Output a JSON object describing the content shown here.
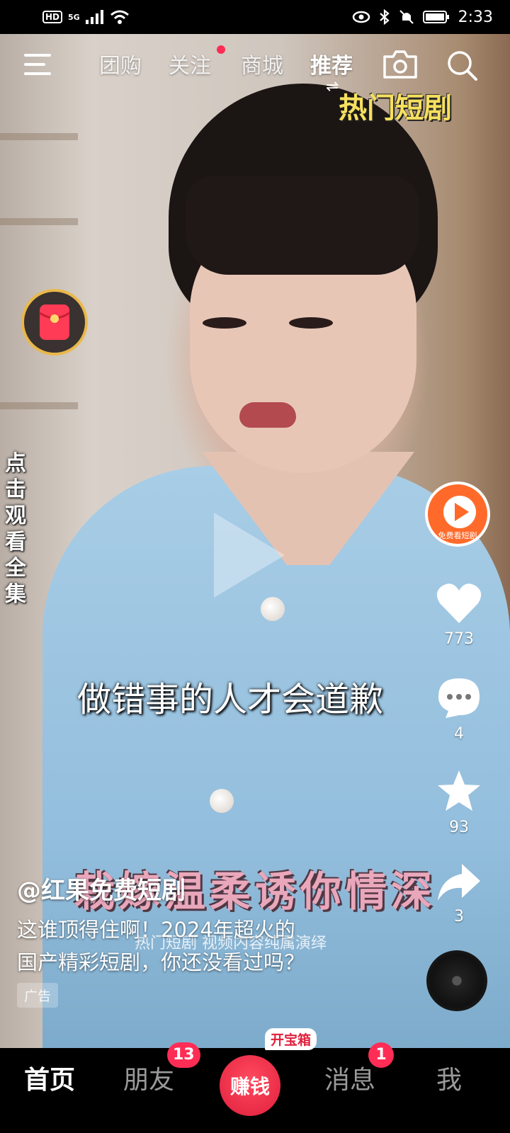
{
  "status_bar": {
    "network_badge": "HD",
    "network_type": "5G",
    "time": "2:33"
  },
  "top_nav": {
    "tabs": [
      {
        "label": "团购"
      },
      {
        "label": "关注",
        "has_dot": true
      },
      {
        "label": "商城"
      },
      {
        "label": "推荐",
        "active": true
      }
    ],
    "hot_tag": "热门短剧",
    "icons": [
      "menu-icon",
      "camera-icon",
      "search-icon"
    ]
  },
  "video": {
    "side_caption": [
      "点",
      "击",
      "观",
      "看",
      "全",
      "集"
    ],
    "subtitle": "做错事的人才会道歉",
    "promo_title": "栽嫁温柔诱你情深",
    "disclaimer": "热门短剧 视频内容纯属演绎"
  },
  "right_rail": {
    "app_label": "免费看短剧",
    "likes": "773",
    "comments": "4",
    "favorites": "93",
    "shares": "3"
  },
  "post": {
    "author": "@红果免费短剧",
    "description_line1": "这谁顶得住啊！2024年超火的",
    "description_line2": "国产精彩短剧，你还没看过吗？",
    "ad_label": "广告"
  },
  "bottom_nav": {
    "home": "首页",
    "friends": "朋友",
    "friends_badge": "13",
    "earn": "赚钱",
    "treasure": "开宝箱",
    "messages": "消息",
    "messages_badge": "1",
    "me": "我"
  },
  "colors": {
    "accent_red": "#ff2d55",
    "earn_red": "#e01f3d",
    "hot_tag_yellow": "#f6e05e"
  }
}
